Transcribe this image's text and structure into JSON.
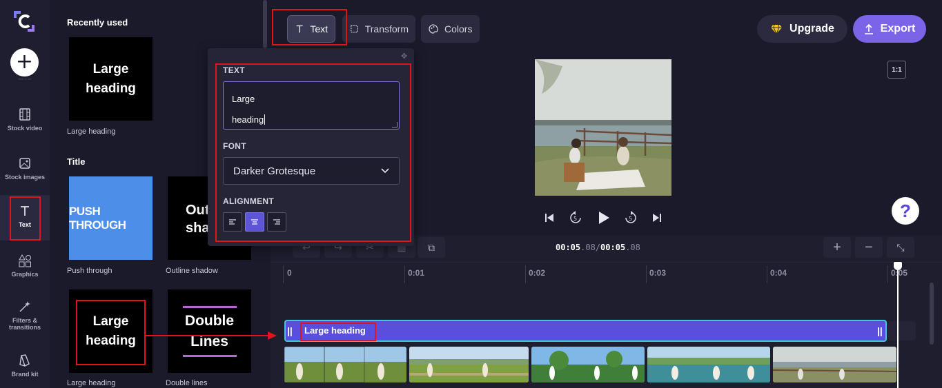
{
  "rail": {
    "items": [
      {
        "label": "Stock video",
        "icon": "film-icon"
      },
      {
        "label": "Stock images",
        "icon": "image-icon"
      },
      {
        "label": "Text",
        "icon": "text-icon",
        "active": true
      },
      {
        "label": "Graphics",
        "icon": "shapes-icon"
      },
      {
        "label": "Filters & transitions",
        "icon": "magic-wand-icon"
      },
      {
        "label": "Brand kit",
        "icon": "brand-kit-icon"
      }
    ]
  },
  "library": {
    "recently_used_title": "Recently used",
    "recent": [
      {
        "thumb_text": "Large heading",
        "caption": "Large heading"
      }
    ],
    "title_section": "Title",
    "titles": [
      {
        "thumb_text": "PUSH THROUGH",
        "caption": "Push through"
      },
      {
        "thumb_text": "Outline shadow",
        "caption": "Outline shadow"
      },
      {
        "thumb_text": "Large heading",
        "caption": "Large heading"
      },
      {
        "thumb_text": "Double Lines",
        "caption": "Double lines"
      }
    ]
  },
  "toolbar": {
    "tabs": [
      {
        "label": "Text",
        "icon": "text-icon",
        "active": true
      },
      {
        "label": "Transform",
        "icon": "crop-icon"
      },
      {
        "label": "Colors",
        "icon": "palette-icon"
      }
    ],
    "upgrade_label": "Upgrade",
    "export_label": "Export"
  },
  "text_panel": {
    "text_label": "TEXT",
    "text_value_line1": "Large",
    "text_value_line2": "heading",
    "font_label": "FONT",
    "font_value": "Darker Grotesque",
    "alignment_label": "ALIGNMENT",
    "alignment_selected": "center"
  },
  "preview": {
    "aspect_ratio": "1:1"
  },
  "timeline": {
    "current_time_main": "00:05",
    "current_time_frac": ".08",
    "total_time_main": "00:05",
    "total_time_frac": ".08",
    "separator": "/",
    "ticks": [
      "0",
      "0:01",
      "0:02",
      "0:03",
      "0:04",
      "0:05"
    ],
    "text_clip_label": "Large heading",
    "playhead_seconds": 5.08
  },
  "colors": {
    "accent": "#7c64e8",
    "text_clip": "#5a4fdc",
    "annotation": "#e0141b"
  }
}
